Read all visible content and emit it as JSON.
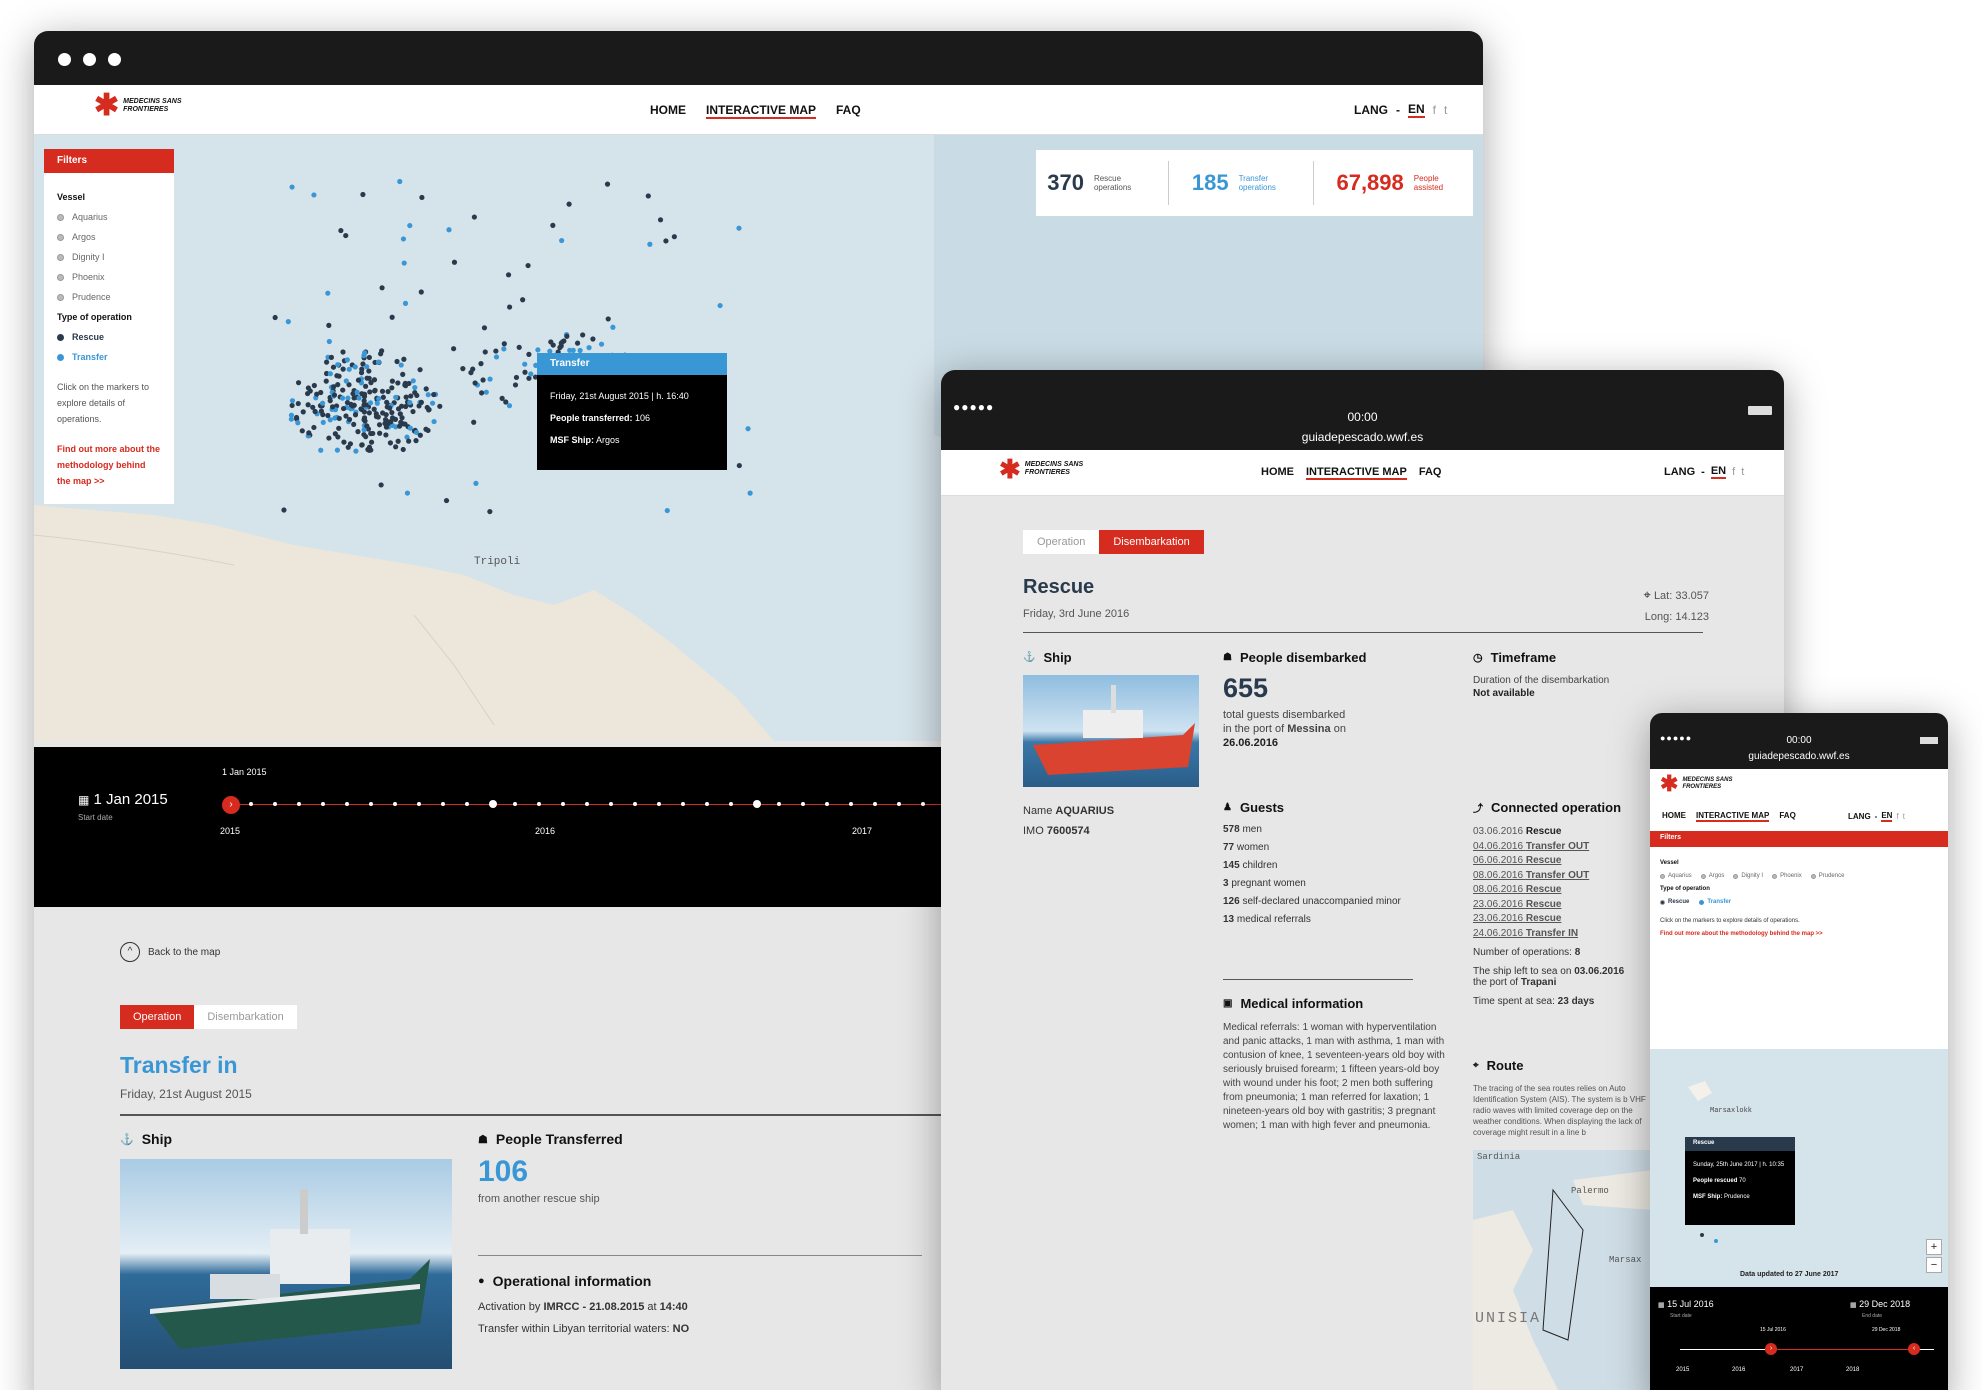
{
  "brand": {
    "logo_text": "MEDECINS SANS FRONTIERES"
  },
  "nav": {
    "home": "HOME",
    "map": "INTERACTIVE MAP",
    "faq": "FAQ",
    "lang": "LANG",
    "en": "EN",
    "sep": "-",
    "fb": "f",
    "tw": "t"
  },
  "desktop": {
    "filters": {
      "title": "Filters",
      "vessel_label": "Vessel",
      "vessels": [
        "Aquarius",
        "Argos",
        "Dignity I",
        "Phoenix",
        "Prudence"
      ],
      "type_label": "Type of operation",
      "types": [
        "Rescue",
        "Transfer"
      ],
      "hint": "Click on the markers to explore details of operations.",
      "methodology": "Find out more about the methodology behind the map >>"
    },
    "stats": [
      {
        "value": "370",
        "label": "Rescue operations"
      },
      {
        "value": "185",
        "label": "Transfer operations"
      },
      {
        "value": "67,898",
        "label": "People assisted"
      }
    ],
    "tooltip": {
      "title": "Transfer",
      "date": "Friday, 21st August 2015 | h. 16:40",
      "people_label": "People transferred:",
      "people_value": "106",
      "ship_label": "MSF Ship:",
      "ship_value": "Argos"
    },
    "map_label": "Tripoli",
    "timeline": {
      "date": "1 Jan 2015",
      "sub": "Start date",
      "marker_label": "1 Jan 2015",
      "years": [
        "2015",
        "2016",
        "2017"
      ]
    },
    "back": "Back to the map",
    "tabs": [
      "Operation",
      "Disembarkation"
    ],
    "title": "Transfer in",
    "date": "Friday, 21st August 2015",
    "ship_title": "Ship",
    "people_title": "People Transferred",
    "people_value": "106",
    "people_sub": "from another rescue ship",
    "op_title": "Operational information",
    "activation_pre": "Activation by",
    "activation_val": "IMRCC - 21.08.2015",
    "activation_at": "at",
    "activation_time": "14:40",
    "waters_label": "Transfer within Libyan territorial waters:",
    "waters_val": "NO"
  },
  "tablet": {
    "time": "00:00",
    "url": "guiadepescado.wwf.es",
    "tabs": [
      "Operation",
      "Disembarkation"
    ],
    "title": "Rescue",
    "date": "Friday, 3rd June 2016",
    "lat": "Lat: 33.057",
    "long": "Long: 14.123",
    "ship_title": "Ship",
    "ship_name_label": "Name",
    "ship_name": "AQUARIUS",
    "imo_label": "IMO",
    "imo": "7600574",
    "people_title": "People disembarked",
    "people_value": "655",
    "people_sub1": "total guests disembarked",
    "people_sub2": "in the port of",
    "port": "Messina",
    "on": "on",
    "people_date": "26.06.2016",
    "timeframe_title": "Timeframe",
    "timeframe_sub": "Duration of the disembarkation",
    "timeframe_val": "Not available",
    "guests_title": "Guests",
    "guests": [
      {
        "n": "578",
        "t": "men"
      },
      {
        "n": "77",
        "t": "women"
      },
      {
        "n": "145",
        "t": "children"
      },
      {
        "n": "3",
        "t": "pregnant women"
      },
      {
        "n": "126",
        "t": "self-declared unaccompanied minor"
      },
      {
        "n": "13",
        "t": "medical referrals"
      }
    ],
    "medical_title": "Medical information",
    "medical_text": "Medical referrals: 1 woman with hyperventilation and panic attacks, 1 man with asthma, 1 man with contusion of knee, 1 seventeen-years old boy with seriously bruised forearm; 1 fifteen years-old boy with wound under his foot; 2 men both suffering from pneumonia; 1 man referred for laxation; 1 nineteen-years old boy with gastritis; 3 pregnant women; 1 man with high fever and pneumonia.",
    "connected_title": "Connected operation",
    "connected": [
      {
        "d": "03.06.2016",
        "t": "Rescue"
      },
      {
        "d": "04.06.2016",
        "t": "Transfer OUT"
      },
      {
        "d": "06.06.2016",
        "t": "Rescue"
      },
      {
        "d": "08.06.2016",
        "t": "Transfer OUT"
      },
      {
        "d": "08.06.2016",
        "t": "Rescue"
      },
      {
        "d": "23.06.2016",
        "t": "Rescue"
      },
      {
        "d": "23.06.2016",
        "t": "Rescue"
      },
      {
        "d": "24.06.2016",
        "t": "Transfer IN"
      }
    ],
    "num_ops_label": "Number of operations:",
    "num_ops": "8",
    "left_pre": "The ship left to sea on",
    "left_date": "03.06.2016",
    "left_port_pre": "the port of",
    "left_port": "Trapani",
    "time_sea_label": "Time spent at sea:",
    "time_sea": "23 days",
    "route_title": "Route",
    "route_text": "The tracing of the sea routes relies on Auto Identification System (AIS). The system is b VHF radio waves with limited coverage dep on the weather conditions. When displaying the lack of coverage might result in a line b",
    "map_labels": [
      "Sardinia",
      "Palermo",
      "Marsax",
      "UNISIA"
    ]
  },
  "mobile": {
    "time": "00:00",
    "url": "guiadepescado.wwf.es",
    "filters_title": "Filters",
    "vessel_label": "Vessel",
    "vessels": [
      "Aquarius",
      "Argos",
      "Dignity I",
      "Phoenix",
      "Prudence"
    ],
    "type_label": "Type of operation",
    "types": [
      "Rescue",
      "Transfer"
    ],
    "hint": "Click on the markers to explore details of operations.",
    "methodology": "Find out more about the methodology behind the map >>",
    "map_label": "Marsaxlokk",
    "tooltip": {
      "title": "Rescue",
      "date": "Sunday, 25th June 2017 | h. 10:35",
      "people_label": "People rescued",
      "people_value": "70",
      "ship_label": "MSF Ship:",
      "ship_value": "Prudence"
    },
    "zoom_in": "+",
    "zoom_out": "−",
    "updated": "Data updated to 27 June 2017",
    "start_date": "15 Jul 2016",
    "start_sub": "Start date",
    "end_date": "29 Dec 2018",
    "end_sub": "End date",
    "marker_start": "15 Jul 2016",
    "marker_end": "29 Dec 2018",
    "years": [
      "2015",
      "2016",
      "2017",
      "2018"
    ]
  }
}
